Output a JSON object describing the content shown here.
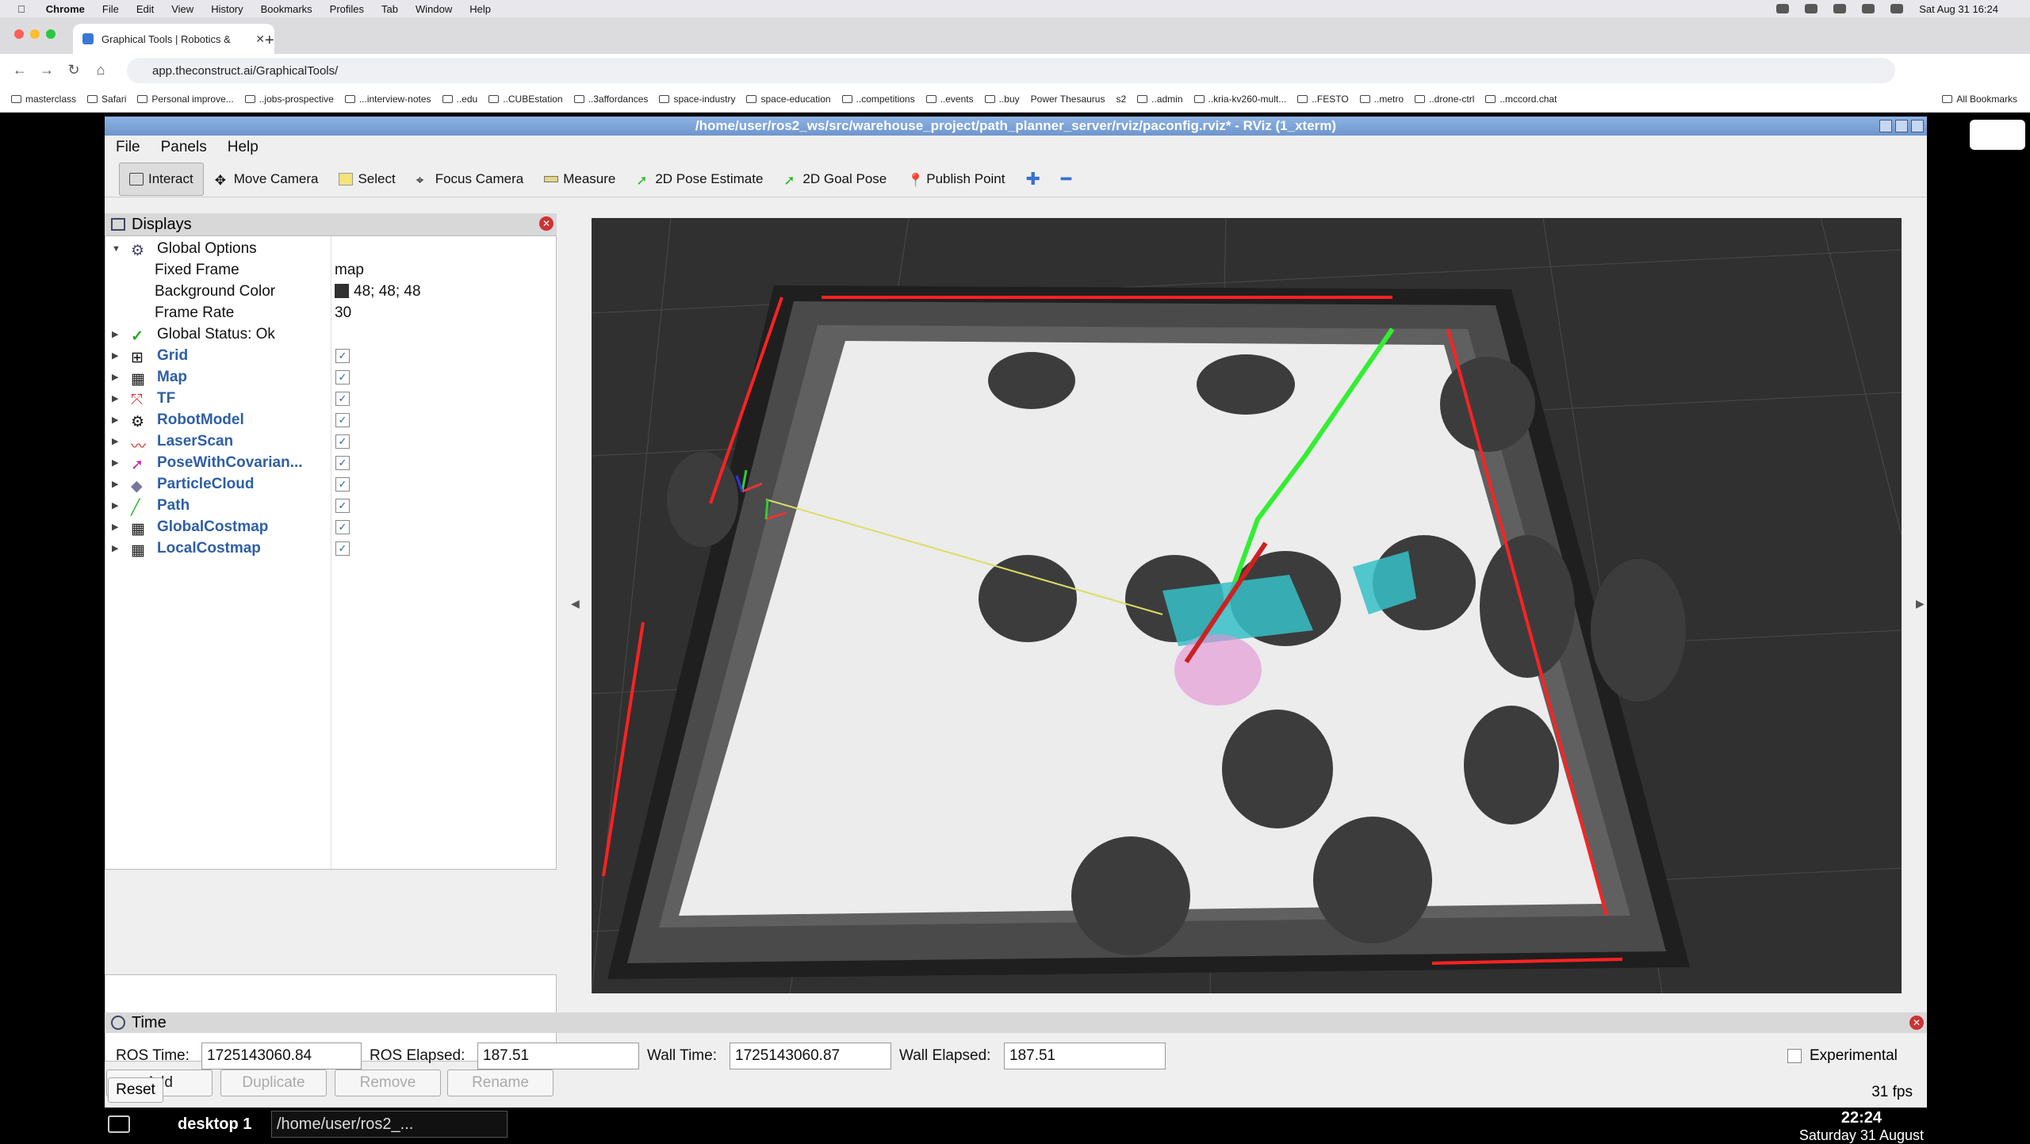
{
  "mac_menubar": {
    "app": "Chrome",
    "items": [
      "File",
      "Edit",
      "View",
      "History",
      "Bookmarks",
      "Profiles",
      "Tab",
      "Window",
      "Help"
    ],
    "datetime": "Sat Aug 31  16:24"
  },
  "browser": {
    "tab_title": "Graphical Tools | Robotics & ",
    "url": "app.theconstruct.ai/GraphicalTools/",
    "bookmarks": [
      "masterclass",
      "Safari",
      "Personal improve...",
      "..jobs-prospective",
      "...interview-notes",
      "..edu",
      "..CUBEstation",
      "..3affordances",
      "space-industry",
      "space-education",
      "..competitions",
      "..events",
      "..buy",
      "Power Thesaurus",
      "s2",
      "..admin",
      "..kria-kv260-mult...",
      "..FESTO",
      "..metro",
      "..drone-ctrl",
      "..mccord.chat"
    ],
    "all_bookmarks": "All Bookmarks"
  },
  "rviz": {
    "window_title": "/home/user/ros2_ws/src/warehouse_project/path_planner_server/rviz/paconfig.rviz* - RViz (1_xterm)",
    "menu": [
      "File",
      "Panels",
      "Help"
    ],
    "tools": [
      "Interact",
      "Move Camera",
      "Select",
      "Focus Camera",
      "Measure",
      "2D Pose Estimate",
      "2D Goal Pose",
      "Publish Point"
    ],
    "displays": {
      "title": "Displays",
      "global_options_label": "Global Options",
      "properties": [
        {
          "name": "Fixed Frame",
          "value": "map"
        },
        {
          "name": "Background Color",
          "value": "48; 48; 48"
        },
        {
          "name": "Frame Rate",
          "value": "30"
        }
      ],
      "global_status": "Global Status: Ok",
      "items": [
        "Grid",
        "Map",
        "TF",
        "RobotModel",
        "LaserScan",
        "PoseWithCovarian...",
        "ParticleCloud",
        "Path",
        "GlobalCostmap",
        "LocalCostmap"
      ],
      "buttons": {
        "add": "Add",
        "duplicate": "Duplicate",
        "remove": "Remove",
        "rename": "Rename"
      }
    },
    "time": {
      "title": "Time",
      "ros_time_label": "ROS Time:",
      "ros_time": "1725143060.84",
      "ros_elapsed_label": "ROS Elapsed:",
      "ros_elapsed": "187.51",
      "wall_time_label": "Wall Time:",
      "wall_time": "1725143060.87",
      "wall_elapsed_label": "Wall Elapsed:",
      "wall_elapsed": "187.51",
      "experimental": "Experimental",
      "reset": "Reset",
      "fps": "31 fps"
    }
  },
  "taskbar": {
    "desktop": "desktop 1",
    "task": "/home/user/ros2_...",
    "time": "22:24",
    "date": "Saturday 31 August"
  },
  "colors": {
    "background": "#303030",
    "path": "#33ee33",
    "laser": "#ff2222",
    "accent": "#2e5fa5"
  }
}
